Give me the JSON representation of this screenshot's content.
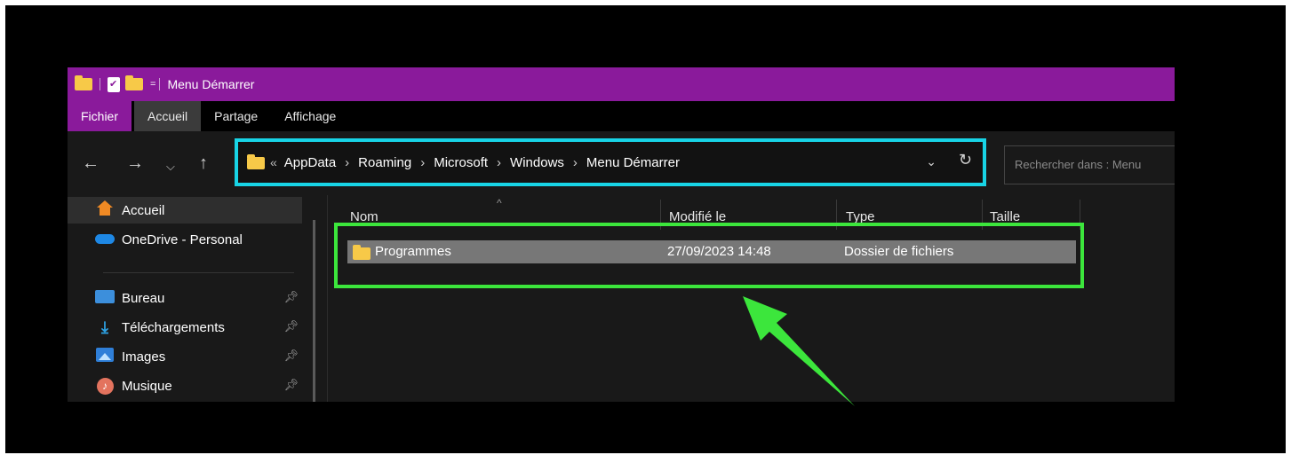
{
  "titlebar": {
    "title": "Menu Démarrer",
    "quick_access_dropdown": "="
  },
  "ribbon": {
    "tabs": [
      {
        "label": "Fichier",
        "state": "file"
      },
      {
        "label": "Accueil",
        "state": "active"
      },
      {
        "label": "Partage",
        "state": "normal"
      },
      {
        "label": "Affichage",
        "state": "normal"
      }
    ]
  },
  "navigation": {
    "back_icon": "arrow-left-icon",
    "forward_icon": "arrow-right-icon",
    "recent_icon": "chevron-down-icon",
    "up_icon": "arrow-up-icon"
  },
  "address": {
    "overflow": "«",
    "crumbs": [
      "AppData",
      "Roaming",
      "Microsoft",
      "Windows",
      "Menu Démarrer"
    ],
    "highlight_color": "#18d4e6"
  },
  "search": {
    "placeholder": "Rechercher dans : Menu"
  },
  "sidebar": {
    "items": [
      {
        "label": "Accueil",
        "icon": "home-icon",
        "selected": true
      },
      {
        "label": "OneDrive - Personal",
        "icon": "cloud-icon"
      },
      {
        "label": "Bureau",
        "icon": "desktop-icon",
        "pinned": true
      },
      {
        "label": "Téléchargements",
        "icon": "download-icon",
        "pinned": true
      },
      {
        "label": "Images",
        "icon": "image-icon",
        "pinned": true
      },
      {
        "label": "Musique",
        "icon": "music-icon",
        "pinned": true
      }
    ]
  },
  "content": {
    "columns": [
      "Nom",
      "Modifié le",
      "Type",
      "Taille"
    ],
    "rows": [
      {
        "name": "Programmes",
        "modified": "27/09/2023 14:48",
        "type": "Dossier de fichiers",
        "size": ""
      }
    ],
    "highlight_color": "#3ce63c"
  },
  "colors": {
    "titlebar": "#8a1a9b",
    "window_bg": "#191919",
    "annotation_arrow": "#3ce63c"
  }
}
